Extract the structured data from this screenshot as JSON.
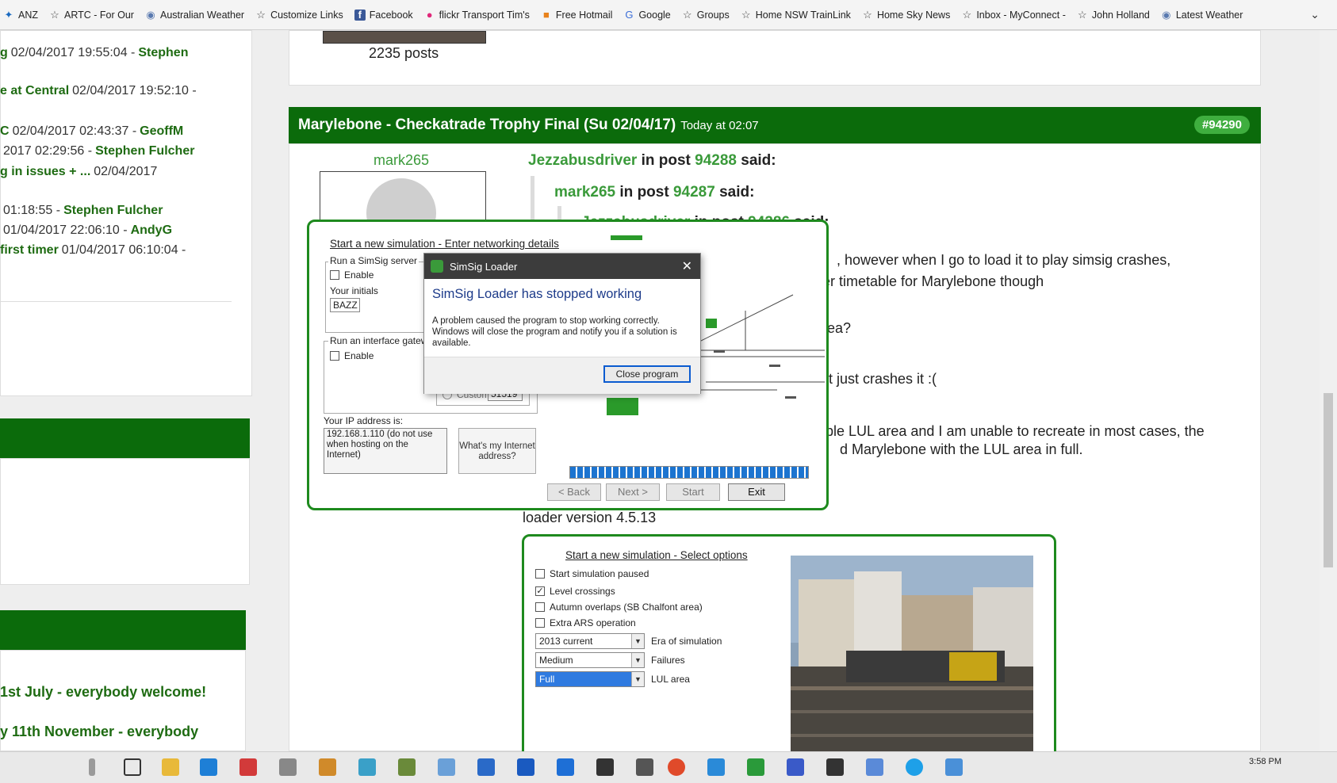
{
  "bookmarks": [
    {
      "label": "ANZ",
      "icon": "anz-icon"
    },
    {
      "label": "ARTC - For Our",
      "icon": "star-icon"
    },
    {
      "label": "Australian Weather",
      "icon": "globe-icon"
    },
    {
      "label": "Customize Links",
      "icon": "star-icon"
    },
    {
      "label": "Facebook",
      "icon": "facebook-icon"
    },
    {
      "label": "flickr Transport Tim's",
      "icon": "flickr-icon"
    },
    {
      "label": "Free Hotmail",
      "icon": "windows-icon"
    },
    {
      "label": "Google",
      "icon": "google-icon"
    },
    {
      "label": "Groups",
      "icon": "star-icon"
    },
    {
      "label": "Home NSW TrainLink",
      "icon": "star-icon"
    },
    {
      "label": "Home Sky News",
      "icon": "star-icon"
    },
    {
      "label": "Inbox - MyConnect -",
      "icon": "star-icon"
    },
    {
      "label": "John Holland",
      "icon": "star-icon"
    },
    {
      "label": "Latest Weather",
      "icon": "globe-icon"
    }
  ],
  "sidebar": {
    "recent": [
      {
        "title": "g",
        "time": "02/04/2017 19:55:04 -",
        "author": "Stephen"
      },
      {
        "title": "e at Central",
        "time": "02/04/2017 19:52:10 -",
        "author": ""
      },
      {
        "title": "C",
        "time": "02/04/2017 02:43:37 -",
        "author": "GeoffM"
      },
      {
        "title": "",
        "time": "2017 02:29:56 -",
        "author": "Stephen Fulcher"
      },
      {
        "title": "g in issues + ...",
        "time": "02/04/2017",
        "author": ""
      },
      {
        "title": "",
        "time": "01:18:55 -",
        "author": "Stephen Fulcher"
      },
      {
        "title": "",
        "time": "01/04/2017 22:06:10 -",
        "author": "AndyG"
      },
      {
        "title": "first timer",
        "time": "01/04/2017 06:10:04 -",
        "author": ""
      }
    ],
    "events": [
      "1st July - everybody welcome!",
      "y 11th November - everybody"
    ]
  },
  "prev_post": {
    "posts": "2235 posts"
  },
  "post": {
    "title": "Marylebone - Checkatrade Trophy Final (Su 02/04/17)",
    "time": "Today at 02:07",
    "number": "#94290",
    "author": "mark265",
    "q1": {
      "user": "Jezzabusdriver",
      "in": "in post",
      "post": "94288",
      "said": "said:"
    },
    "q2": {
      "user": "mark265",
      "in": "in post",
      "post": "94287",
      "said": "said:"
    },
    "q3": {
      "user": "Jezzabusdriver",
      "in": "in post",
      "post": "94286",
      "said": "said:"
    },
    "lines": [
      ", however when I go to load it to play simsig crashes,",
      "er timetable for Marylebone though",
      "rea?",
      "t just crashes it :(",
      "ble LUL area and I am unable to recreate in most cases, the",
      "d Marylebone with the LUL area in full."
    ],
    "version": "loader version 4.5.13"
  },
  "sim_network": {
    "title": "Start a new simulation - Enter networking details",
    "server_group": "Run a SimSig server",
    "enable1": "Enable",
    "initials_label": "Your initials",
    "initials_value": "BAZZ",
    "gateway_group": "Run an interface gatewa",
    "enable2": "Enable",
    "custom_label": "Custom:",
    "custom_value": "51519",
    "ip_label": "Your IP address is:",
    "ip_value": "192.168.1.110 (do not use when hosting on the Internet)",
    "whats_ip": "What's my Internet address?",
    "back": "< Back",
    "next": "Next >",
    "start": "Start",
    "exit": "Exit"
  },
  "error_dialog": {
    "window_title": "SimSig Loader",
    "heading": "SimSig Loader has stopped working",
    "message": "A problem caused the program to stop working correctly. Windows will close the program and notify you if a solution is available.",
    "button": "Close program"
  },
  "sim_options": {
    "title": "Start a new simulation - Select options",
    "checks": [
      {
        "label": "Start simulation paused",
        "checked": false
      },
      {
        "label": "Level crossings",
        "checked": true
      },
      {
        "label": "Autumn overlaps (SB Chalfont area)",
        "checked": false
      },
      {
        "label": "Extra ARS operation",
        "checked": false
      }
    ],
    "selects": [
      {
        "value": "2013 current",
        "label": "Era of simulation"
      },
      {
        "value": "Medium",
        "label": "Failures"
      },
      {
        "value": "Full",
        "label": "LUL area"
      }
    ]
  },
  "taskbar": {
    "clock": "3:58 PM"
  },
  "colors": {
    "forum_green": "#0b6b0b",
    "link_green": "#3a9a3a",
    "badge": "#3fae3f",
    "progress": "#1c74d0"
  }
}
